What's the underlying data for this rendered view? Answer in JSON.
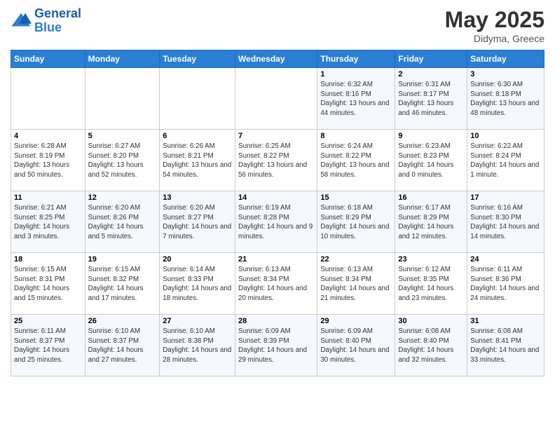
{
  "header": {
    "logo_line1": "General",
    "logo_line2": "Blue",
    "title": "May 2025",
    "subtitle": "Didyma, Greece"
  },
  "days_of_week": [
    "Sunday",
    "Monday",
    "Tuesday",
    "Wednesday",
    "Thursday",
    "Friday",
    "Saturday"
  ],
  "weeks": [
    [
      {
        "day": "",
        "info": ""
      },
      {
        "day": "",
        "info": ""
      },
      {
        "day": "",
        "info": ""
      },
      {
        "day": "",
        "info": ""
      },
      {
        "day": "1",
        "info": "Sunrise: 6:32 AM\nSunset: 8:16 PM\nDaylight: 13 hours and 44 minutes."
      },
      {
        "day": "2",
        "info": "Sunrise: 6:31 AM\nSunset: 8:17 PM\nDaylight: 13 hours and 46 minutes."
      },
      {
        "day": "3",
        "info": "Sunrise: 6:30 AM\nSunset: 8:18 PM\nDaylight: 13 hours and 48 minutes."
      }
    ],
    [
      {
        "day": "4",
        "info": "Sunrise: 6:28 AM\nSunset: 8:19 PM\nDaylight: 13 hours and 50 minutes."
      },
      {
        "day": "5",
        "info": "Sunrise: 6:27 AM\nSunset: 8:20 PM\nDaylight: 13 hours and 52 minutes."
      },
      {
        "day": "6",
        "info": "Sunrise: 6:26 AM\nSunset: 8:21 PM\nDaylight: 13 hours and 54 minutes."
      },
      {
        "day": "7",
        "info": "Sunrise: 6:25 AM\nSunset: 8:22 PM\nDaylight: 13 hours and 56 minutes."
      },
      {
        "day": "8",
        "info": "Sunrise: 6:24 AM\nSunset: 8:22 PM\nDaylight: 13 hours and 58 minutes."
      },
      {
        "day": "9",
        "info": "Sunrise: 6:23 AM\nSunset: 8:23 PM\nDaylight: 14 hours and 0 minutes."
      },
      {
        "day": "10",
        "info": "Sunrise: 6:22 AM\nSunset: 8:24 PM\nDaylight: 14 hours and 1 minute."
      }
    ],
    [
      {
        "day": "11",
        "info": "Sunrise: 6:21 AM\nSunset: 8:25 PM\nDaylight: 14 hours and 3 minutes."
      },
      {
        "day": "12",
        "info": "Sunrise: 6:20 AM\nSunset: 8:26 PM\nDaylight: 14 hours and 5 minutes."
      },
      {
        "day": "13",
        "info": "Sunrise: 6:20 AM\nSunset: 8:27 PM\nDaylight: 14 hours and 7 minutes."
      },
      {
        "day": "14",
        "info": "Sunrise: 6:19 AM\nSunset: 8:28 PM\nDaylight: 14 hours and 9 minutes."
      },
      {
        "day": "15",
        "info": "Sunrise: 6:18 AM\nSunset: 8:29 PM\nDaylight: 14 hours and 10 minutes."
      },
      {
        "day": "16",
        "info": "Sunrise: 6:17 AM\nSunset: 8:29 PM\nDaylight: 14 hours and 12 minutes."
      },
      {
        "day": "17",
        "info": "Sunrise: 6:16 AM\nSunset: 8:30 PM\nDaylight: 14 hours and 14 minutes."
      }
    ],
    [
      {
        "day": "18",
        "info": "Sunrise: 6:15 AM\nSunset: 8:31 PM\nDaylight: 14 hours and 15 minutes."
      },
      {
        "day": "19",
        "info": "Sunrise: 6:15 AM\nSunset: 8:32 PM\nDaylight: 14 hours and 17 minutes."
      },
      {
        "day": "20",
        "info": "Sunrise: 6:14 AM\nSunset: 8:33 PM\nDaylight: 14 hours and 18 minutes."
      },
      {
        "day": "21",
        "info": "Sunrise: 6:13 AM\nSunset: 8:34 PM\nDaylight: 14 hours and 20 minutes."
      },
      {
        "day": "22",
        "info": "Sunrise: 6:13 AM\nSunset: 8:34 PM\nDaylight: 14 hours and 21 minutes."
      },
      {
        "day": "23",
        "info": "Sunrise: 6:12 AM\nSunset: 8:35 PM\nDaylight: 14 hours and 23 minutes."
      },
      {
        "day": "24",
        "info": "Sunrise: 6:11 AM\nSunset: 8:36 PM\nDaylight: 14 hours and 24 minutes."
      }
    ],
    [
      {
        "day": "25",
        "info": "Sunrise: 6:11 AM\nSunset: 8:37 PM\nDaylight: 14 hours and 25 minutes."
      },
      {
        "day": "26",
        "info": "Sunrise: 6:10 AM\nSunset: 8:37 PM\nDaylight: 14 hours and 27 minutes."
      },
      {
        "day": "27",
        "info": "Sunrise: 6:10 AM\nSunset: 8:38 PM\nDaylight: 14 hours and 28 minutes."
      },
      {
        "day": "28",
        "info": "Sunrise: 6:09 AM\nSunset: 8:39 PM\nDaylight: 14 hours and 29 minutes."
      },
      {
        "day": "29",
        "info": "Sunrise: 6:09 AM\nSunset: 8:40 PM\nDaylight: 14 hours and 30 minutes."
      },
      {
        "day": "30",
        "info": "Sunrise: 6:08 AM\nSunset: 8:40 PM\nDaylight: 14 hours and 32 minutes."
      },
      {
        "day": "31",
        "info": "Sunrise: 6:08 AM\nSunset: 8:41 PM\nDaylight: 14 hours and 33 minutes."
      }
    ]
  ]
}
